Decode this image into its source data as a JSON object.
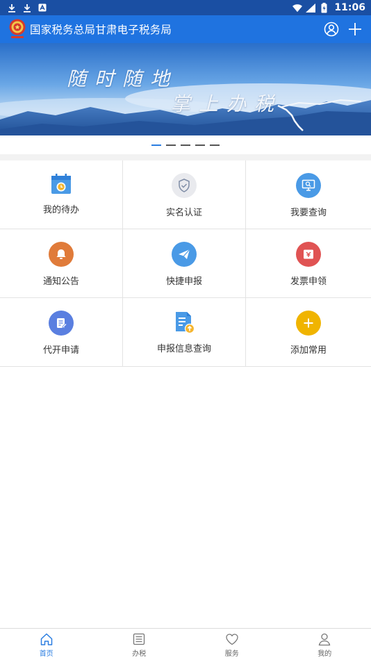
{
  "status_bar": {
    "time": "11:06"
  },
  "header": {
    "title": "国家税务总局甘肃电子税务局"
  },
  "banner": {
    "line1": "随时随地",
    "line2": "掌上办税"
  },
  "pager": {
    "count": 5,
    "active": 0
  },
  "tiles": [
    {
      "label": "我的待办",
      "icon": "calendar-clock-icon",
      "color": "#4a9ae6"
    },
    {
      "label": "实名认证",
      "icon": "shield-check-icon",
      "color": "#e9eaee"
    },
    {
      "label": "我要查询",
      "icon": "monitor-search-icon",
      "color": "#4a9ae6"
    },
    {
      "label": "通知公告",
      "icon": "bell-icon",
      "color": "#e07b3a"
    },
    {
      "label": "快捷申报",
      "icon": "paper-plane-icon",
      "color": "#4a9ae6"
    },
    {
      "label": "发票申领",
      "icon": "invoice-icon",
      "color": "#e05353"
    },
    {
      "label": "代开申请",
      "icon": "document-edit-icon",
      "color": "#5a7fe0"
    },
    {
      "label": "申报信息查询",
      "icon": "document-upload-icon",
      "color": "#4a9ae6"
    },
    {
      "label": "添加常用",
      "icon": "plus-icon",
      "color": "#f0b400"
    }
  ],
  "nav": [
    {
      "label": "首页",
      "icon": "home-icon",
      "active": true
    },
    {
      "label": "办税",
      "icon": "list-icon",
      "active": false
    },
    {
      "label": "服务",
      "icon": "heart-icon",
      "active": false
    },
    {
      "label": "我的",
      "icon": "user-icon",
      "active": false
    }
  ],
  "colors": {
    "status_bar": "#1a4fa3",
    "header": "#1f73e0",
    "accent": "#2a7de1"
  }
}
